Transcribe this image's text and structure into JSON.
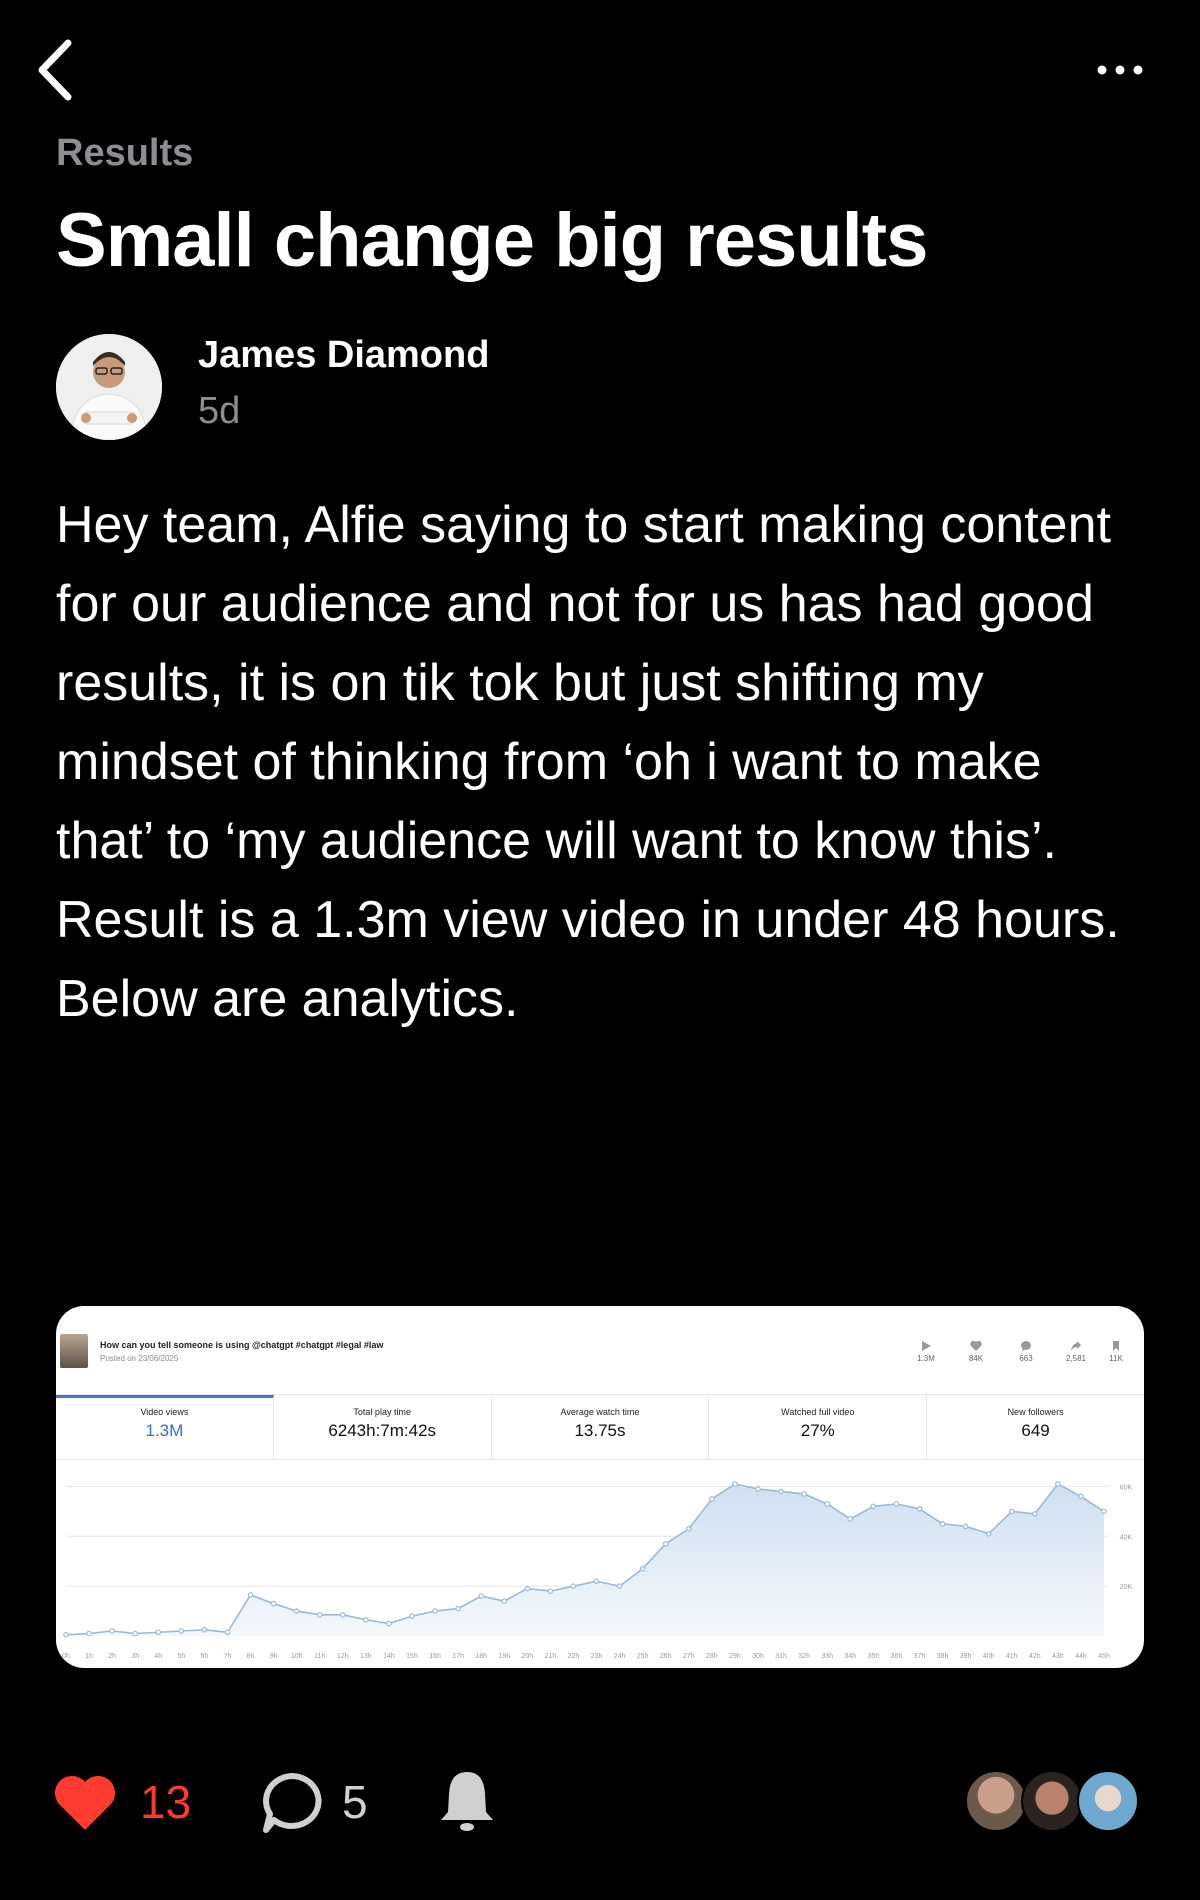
{
  "header": {
    "section": "Results",
    "title": "Small change big results"
  },
  "post": {
    "author": "James Diamond",
    "age": "5d",
    "body": "Hey team, Alfie saying to start making content for our audience and not for us has had good results, it is on tik tok but just shifting my mindset of thinking from ‘oh i want to make that’ to ‘my audience will want to know this’. Result is a 1.3m view video in under 48 hours. Below are analytics."
  },
  "analytics": {
    "video_title": "How can you tell someone is using @chatgpt #chatgpt #legal #law",
    "posted": "Posted on 23/06/2025",
    "stats": [
      {
        "icon": "play-icon",
        "value": "1.3M"
      },
      {
        "icon": "heart-icon",
        "value": "84K"
      },
      {
        "icon": "comment-icon",
        "value": "663"
      },
      {
        "icon": "share-icon",
        "value": "2,581"
      },
      {
        "icon": "bookmark-icon",
        "value": "11K"
      }
    ],
    "tabs": [
      {
        "label": "Video views",
        "value": "1.3M"
      },
      {
        "label": "Total play time",
        "value": "6243h:7m:42s"
      },
      {
        "label": "Average watch time",
        "value": "13.75s"
      },
      {
        "label": "Watched full video",
        "value": "27%"
      },
      {
        "label": "New followers",
        "value": "649"
      }
    ]
  },
  "chart_data": {
    "type": "area",
    "x": [
      "0h",
      "1h",
      "2h",
      "3h",
      "4h",
      "5h",
      "6h",
      "7h",
      "8h",
      "9h",
      "10h",
      "11h",
      "12h",
      "13h",
      "14h",
      "15h",
      "16h",
      "17h",
      "18h",
      "19h",
      "20h",
      "21h",
      "22h",
      "23h",
      "24h",
      "25h",
      "26h",
      "27h",
      "28h",
      "29h",
      "30h",
      "31h",
      "32h",
      "33h",
      "34h",
      "35h",
      "36h",
      "37h",
      "38h",
      "39h",
      "40h",
      "41h",
      "42h",
      "43h",
      "44h",
      "45h"
    ],
    "values": [
      500,
      1000,
      2000,
      1000,
      1500,
      2000,
      2500,
      1500,
      16500,
      13000,
      10000,
      8500,
      8500,
      6500,
      5000,
      8000,
      10000,
      11000,
      16000,
      14000,
      19000,
      18000,
      20000,
      22000,
      20000,
      27000,
      37000,
      43000,
      55000,
      61000,
      59000,
      58000,
      57000,
      53000,
      47000,
      52000,
      53000,
      51000,
      45000,
      44000,
      41000,
      50000,
      49000,
      61000,
      56000,
      50000
    ],
    "yticks": [
      "60K",
      "40K",
      "20K"
    ],
    "ylim": [
      0,
      65000
    ],
    "grid": true,
    "color": "#9ab9d9"
  },
  "footer": {
    "likes": "13",
    "comments": "5",
    "like_color": "#ff3b30"
  }
}
